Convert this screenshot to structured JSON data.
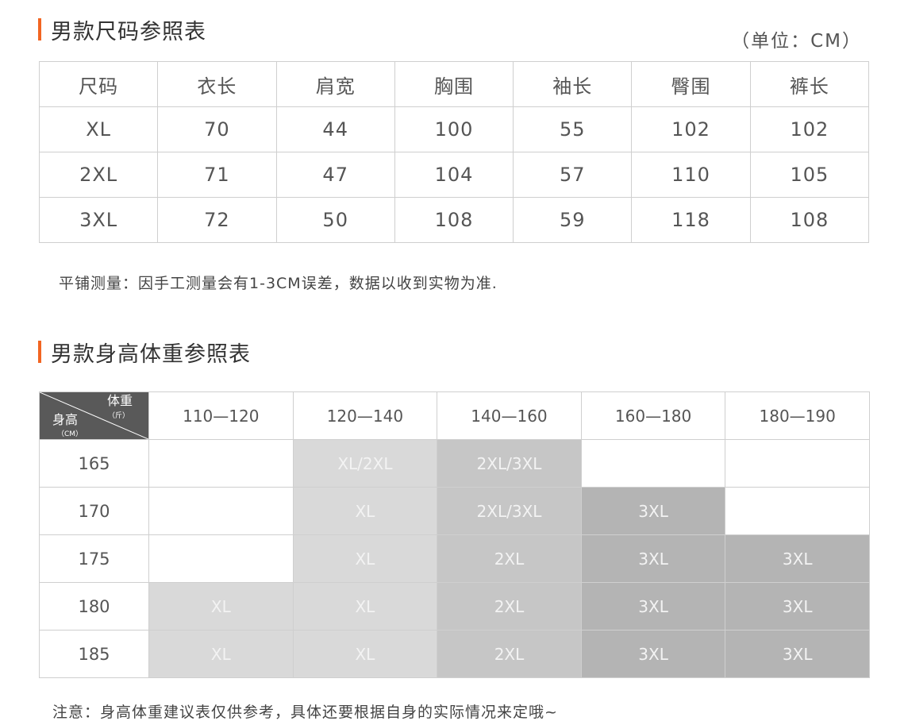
{
  "size_chart": {
    "title": "男款尺码参照表",
    "unit": "（单位：CM）",
    "headers": [
      "尺码",
      "衣长",
      "肩宽",
      "胸围",
      "袖长",
      "臀围",
      "裤长"
    ],
    "rows": [
      [
        "XL",
        "70",
        "44",
        "100",
        "55",
        "102",
        "102"
      ],
      [
        "2XL",
        "71",
        "47",
        "104",
        "57",
        "110",
        "105"
      ],
      [
        "3XL",
        "72",
        "50",
        "108",
        "59",
        "118",
        "108"
      ]
    ],
    "note": "平铺测量：因手工测量会有1-3CM误差，数据以收到实物为准."
  },
  "height_weight": {
    "title": "男款身高体重参照表",
    "corner": {
      "weight_label": "体重",
      "weight_unit": "（斤）",
      "height_label": "身高",
      "height_unit": "（CM）"
    },
    "weight_ranges": [
      "110—120",
      "120—140",
      "140—160",
      "160—180",
      "180—190"
    ],
    "rows": [
      {
        "height": "165",
        "cells": [
          "",
          "XL/2XL",
          "2XL/3XL",
          "",
          ""
        ]
      },
      {
        "height": "170",
        "cells": [
          "",
          "XL",
          "2XL/3XL",
          "3XL",
          ""
        ]
      },
      {
        "height": "175",
        "cells": [
          "",
          "XL",
          "2XL",
          "3XL",
          "3XL"
        ]
      },
      {
        "height": "180",
        "cells": [
          "XL",
          "XL",
          "2XL",
          "3XL",
          "3XL"
        ]
      },
      {
        "height": "185",
        "cells": [
          "XL",
          "XL",
          "2XL",
          "3XL",
          "3XL"
        ]
      }
    ],
    "note": "注意：身高体重建议表仅供参考，具体还要根据自身的实际情况来定哦~"
  },
  "colors": {
    "accent": "#f26522",
    "border": "#cfcfcf",
    "corner_bg": "#595959",
    "fill_xl": "#d9d9d9",
    "fill_2xl": "#c6c6c6",
    "fill_3xl": "#b4b4b4"
  }
}
